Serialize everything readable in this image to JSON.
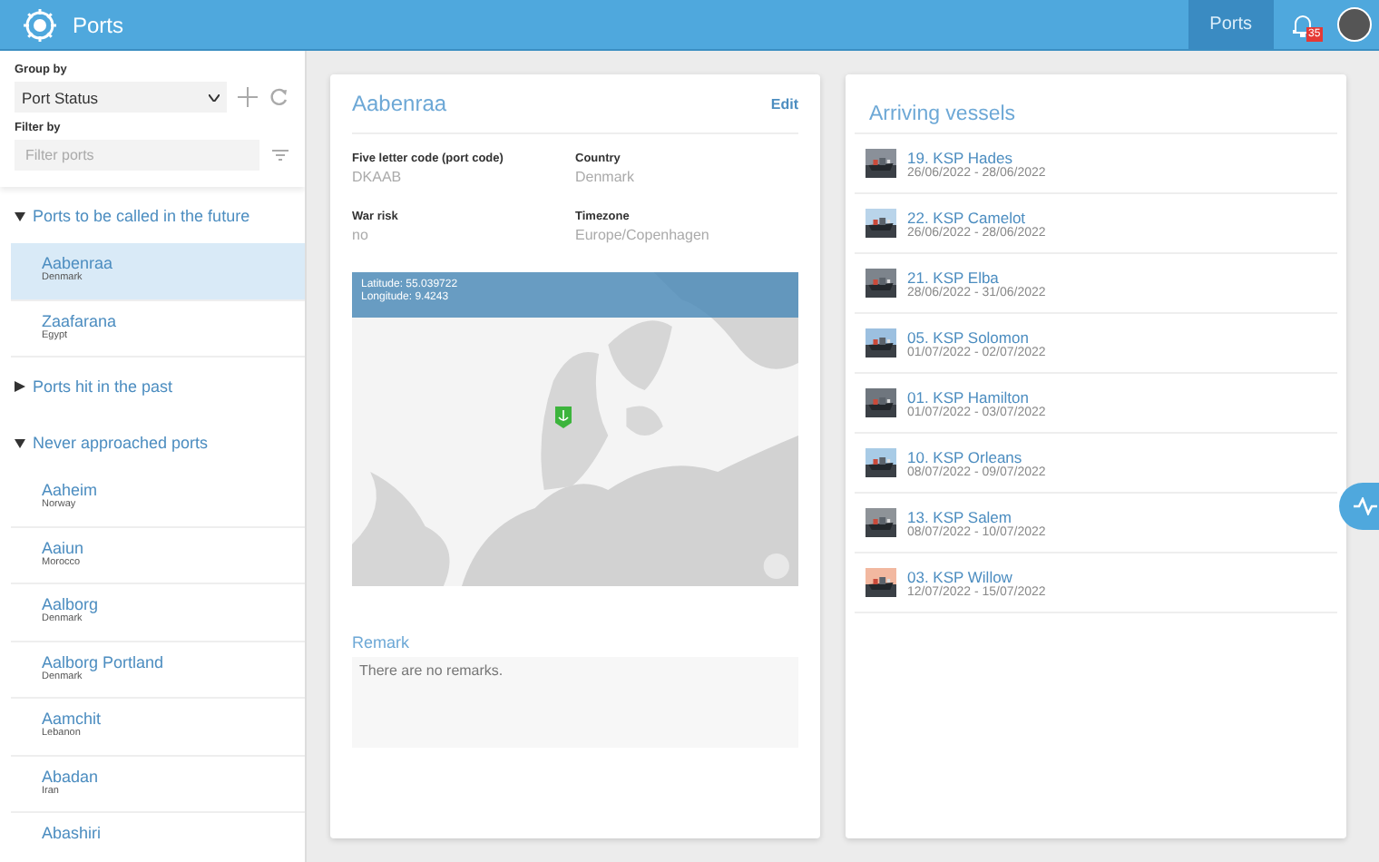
{
  "header": {
    "title": "Ports",
    "nav": [
      {
        "label": "Ports",
        "selected": true
      }
    ],
    "notifications": {
      "badge": "35"
    }
  },
  "sidebar": {
    "group_by_label": "Group by",
    "group_by_value": "Port Status",
    "filter_label": "Filter by",
    "filter_placeholder": "Filter ports",
    "groups": [
      {
        "label": "Ports to be called in the future",
        "expanded": true,
        "items": [
          {
            "name": "Aabenraa",
            "country": "Denmark",
            "selected": true
          },
          {
            "name": "Zaafarana",
            "country": "Egypt",
            "selected": false
          }
        ]
      },
      {
        "label": "Ports hit in the past",
        "expanded": false
      },
      {
        "label": "Never approached ports",
        "expanded": true,
        "items": [
          {
            "name": "Aaheim",
            "country": "Norway",
            "selected": false
          },
          {
            "name": "Aaiun",
            "country": "Morocco",
            "selected": false
          },
          {
            "name": "Aalborg",
            "country": "Denmark",
            "selected": false
          },
          {
            "name": "Aalborg Portland",
            "country": "Denmark",
            "selected": false
          },
          {
            "name": "Aamchit",
            "country": "Lebanon",
            "selected": false
          },
          {
            "name": "Abadan",
            "country": "Iran",
            "selected": false
          },
          {
            "name": "Abashiri",
            "selected": false
          }
        ]
      }
    ]
  },
  "detail": {
    "title": "Aabenraa",
    "edit": "Edit",
    "fields": [
      {
        "label": "Five letter code (port code)",
        "value": "DKAAB"
      },
      {
        "label": "Country",
        "value": "Denmark"
      },
      {
        "label": "War risk",
        "value": "no"
      },
      {
        "label": "Timezone",
        "value": "Europe/Copenhagen"
      }
    ],
    "map": {
      "latitude": "Latitude: 55.039722",
      "longitude": "Longitude: 9.4243"
    },
    "remark_label": "Remark",
    "remark_text": "There are no remarks."
  },
  "vessels": {
    "title": "Arriving vessels",
    "items": [
      {
        "name": "19. KSP Hades",
        "dates": "26/06/2022 - 28/06/2022"
      },
      {
        "name": "22. KSP Camelot",
        "dates": "26/06/2022 - 28/06/2022"
      },
      {
        "name": "21. KSP Elba",
        "dates": "28/06/2022 - 31/06/2022"
      },
      {
        "name": "05. KSP Solomon",
        "dates": "01/07/2022 - 02/07/2022"
      },
      {
        "name": "01. KSP Hamilton",
        "dates": "01/07/2022 - 03/07/2022"
      },
      {
        "name": "10. KSP Orleans",
        "dates": "08/07/2022 - 09/07/2022"
      },
      {
        "name": "13. KSP Salem",
        "dates": "08/07/2022 - 10/07/2022"
      },
      {
        "name": "03. KSP Willow",
        "dates": "12/07/2022 - 15/07/2022"
      }
    ]
  }
}
